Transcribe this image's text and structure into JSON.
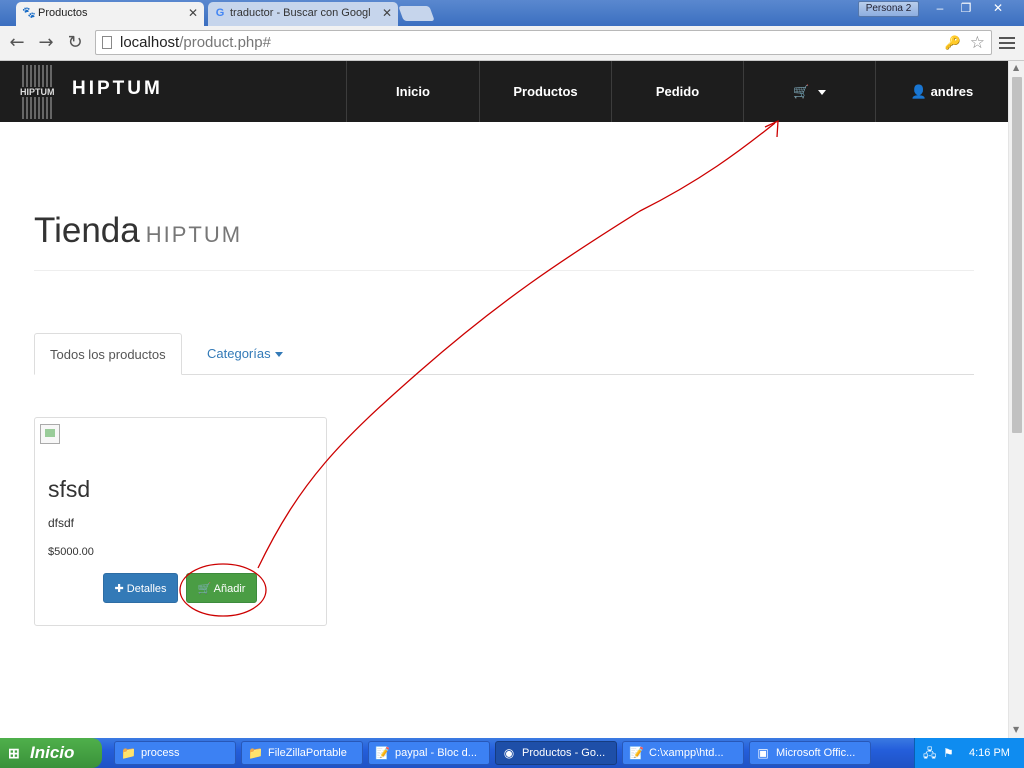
{
  "browser": {
    "tabs": [
      {
        "title": "Productos",
        "icon": "paw-icon"
      },
      {
        "title": "traductor - Buscar con Googl",
        "icon": "google-icon"
      }
    ],
    "profile": "Persona 2",
    "window_buttons": {
      "minimize": "–",
      "restore": "❐",
      "close": "✕"
    },
    "url_host": "localhost",
    "url_path": "/product.php#"
  },
  "site": {
    "brand": "HIPTUM",
    "logo_text": "HIPTUM",
    "nav": [
      {
        "label": "Inicio"
      },
      {
        "label": "Productos"
      },
      {
        "label": "Pedido"
      },
      {
        "label": "",
        "icon": "cart-icon"
      },
      {
        "label": "andres",
        "icon": "user-icon"
      }
    ]
  },
  "page": {
    "title": "Tienda",
    "title_small": "HIPTUM",
    "tabs": [
      {
        "label": "Todos los productos",
        "active": true
      },
      {
        "label": "Categorías",
        "active": false
      }
    ]
  },
  "product": {
    "name": "sfsd",
    "description": "dfsdf",
    "price": "$5000.00",
    "details_label": "Detalles",
    "add_label": "Añadir"
  },
  "taskbar": {
    "start_label": "Inicio",
    "items": [
      {
        "label": "process",
        "icon": "folder-icon"
      },
      {
        "label": "FileZillaPortable",
        "icon": "folder-icon"
      },
      {
        "label": "paypal - Bloc d...",
        "icon": "notepad-icon"
      },
      {
        "label": "Productos - Go...",
        "icon": "chrome-icon",
        "active": true
      },
      {
        "label": "C:\\xampp\\htd...",
        "icon": "notepad-icon"
      },
      {
        "label": "Microsoft Offic...",
        "icon": "office-icon"
      }
    ],
    "clock": "4:16 PM"
  },
  "colors": {
    "navbar": "#1d1d1d",
    "primary": "#337ab7",
    "success": "#4a9d44",
    "annotation": "#cc0000"
  }
}
